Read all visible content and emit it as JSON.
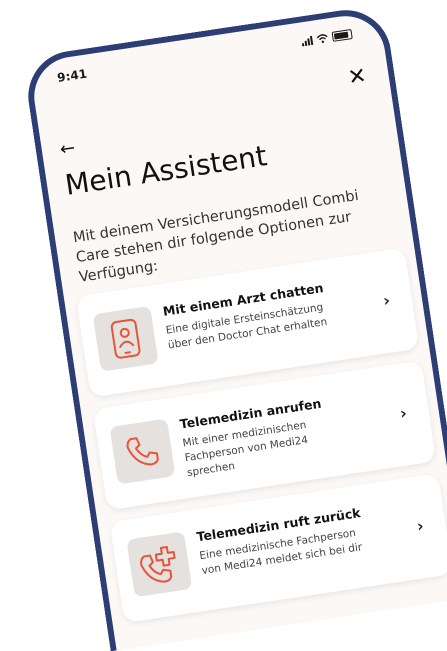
{
  "status_bar": {
    "time": "9:41"
  },
  "header": {
    "title": "Mein Assistent"
  },
  "intro": "Mit deinem Versicherungsmodell Combi Care stehen dir folgende Optionen zur Verfügung:",
  "options": [
    {
      "title": "Mit einem Arzt chatten",
      "description": "Eine digitale Ersteinschätzung über den Doctor Chat erhalten",
      "icon": "doctor-chat-icon"
    },
    {
      "title": "Telemedizin anrufen",
      "description": "Mit einer medizinischen Fachperson von Medi24 sprechen",
      "icon": "phone-icon"
    },
    {
      "title": "Telemedizin ruft zurück",
      "description": "Eine medizinische Fachperson von Medi24 meldet sich bei dir",
      "icon": "phone-callback-icon"
    }
  ],
  "colors": {
    "accent": "#e8543a",
    "frame": "#2c3e73",
    "icon_bg": "#e4e1df"
  }
}
